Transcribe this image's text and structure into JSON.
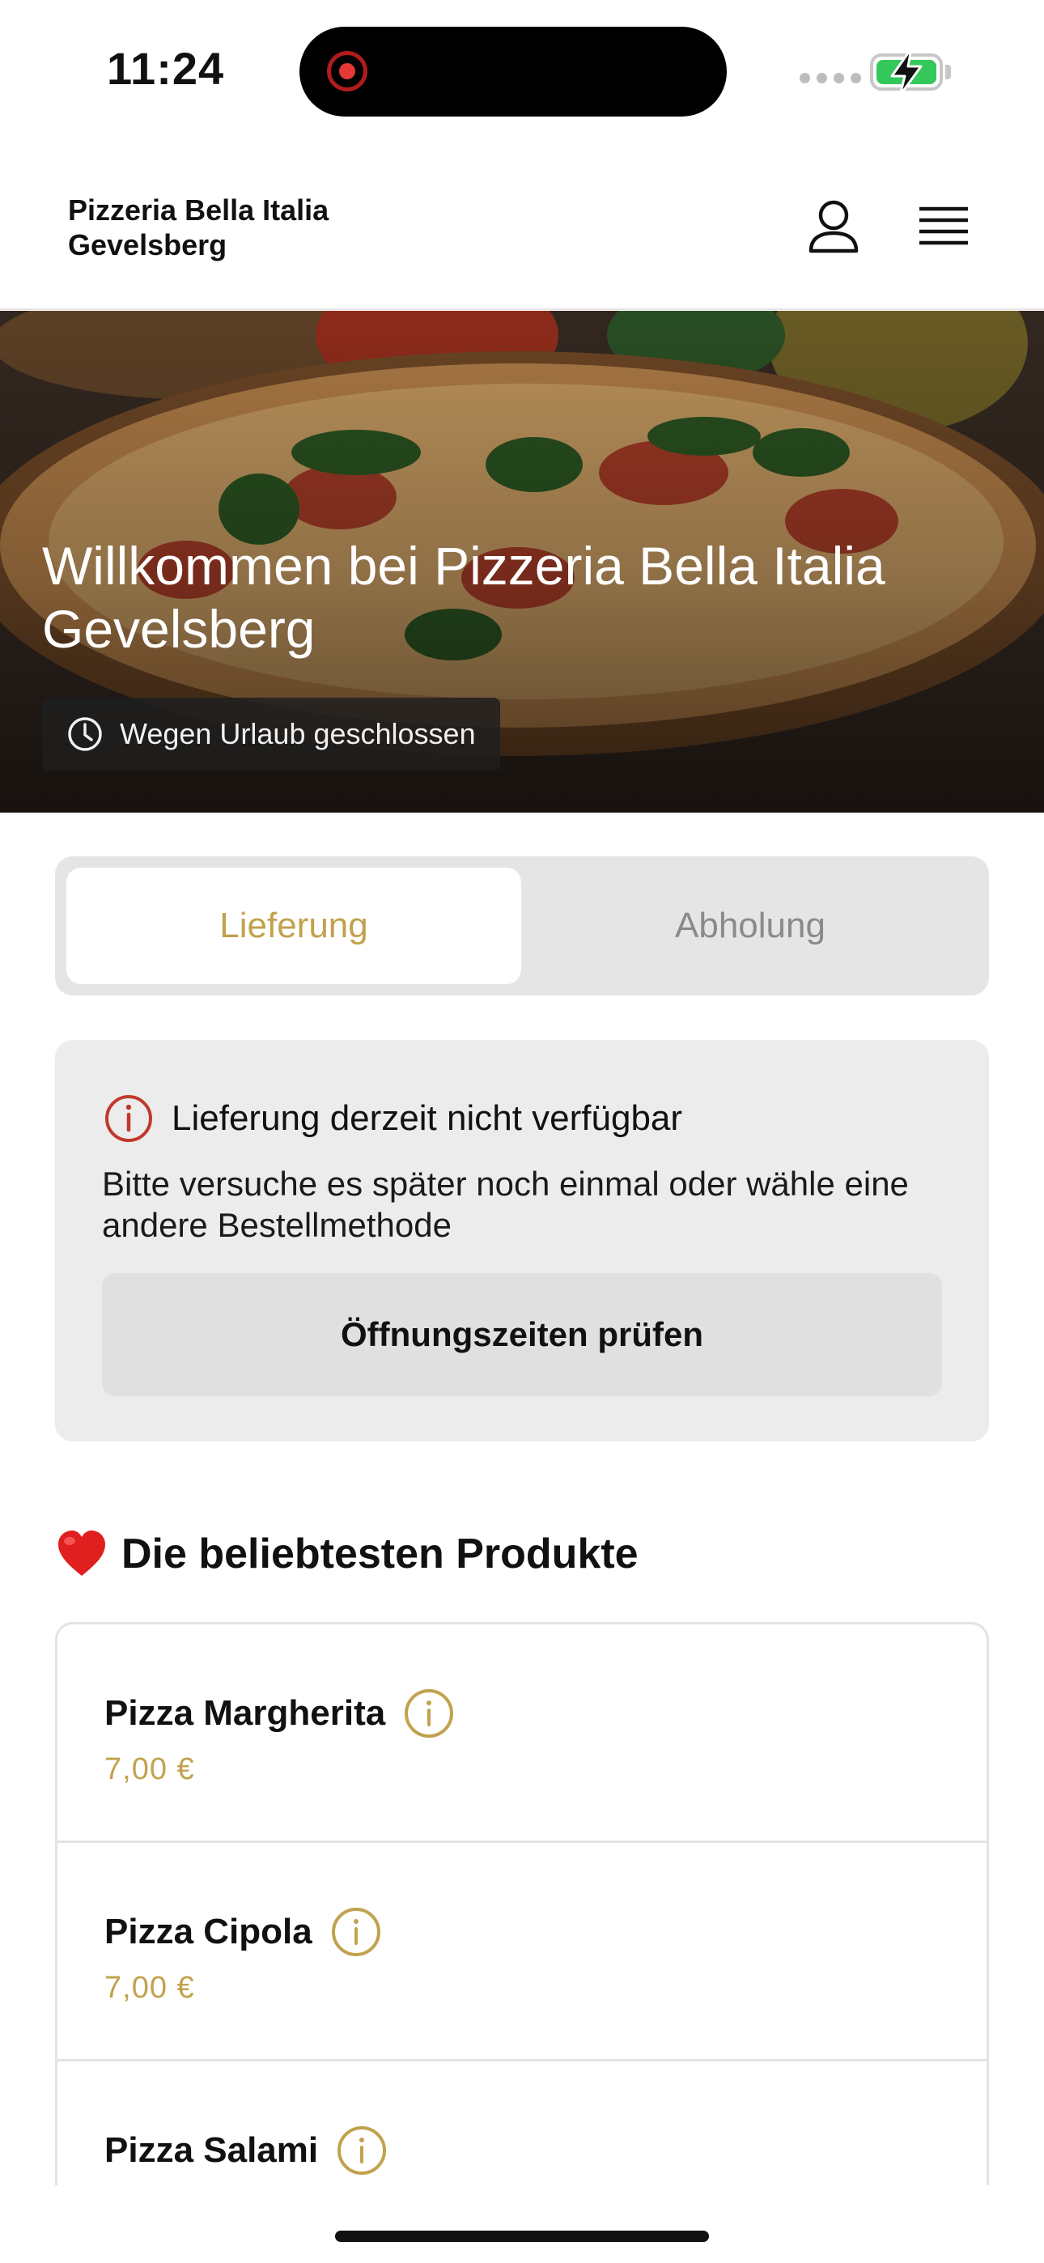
{
  "status_bar": {
    "time": "11:24"
  },
  "header": {
    "brand_line1": "Pizzeria Bella Italia",
    "brand_line2": "Gevelsberg"
  },
  "hero": {
    "title": "Willkommen bei Pizzeria Bella Italia Gevelsberg",
    "badge": "Wegen Urlaub geschlossen"
  },
  "order_mode": {
    "tabs": [
      "Lieferung",
      "Abholung"
    ],
    "selected": "Lieferung"
  },
  "notice": {
    "title": "Lieferung derzeit nicht verfügbar",
    "text": "Bitte versuche es später noch einmal oder wähle eine andere Bestellmethode",
    "button": "Öffnungszeiten prüfen"
  },
  "popular": {
    "heading": "Die beliebtesten Produkte",
    "items": [
      {
        "name": "Pizza Margherita",
        "price": "7,00 €"
      },
      {
        "name": "Pizza Cipola",
        "price": "7,00 €"
      },
      {
        "name": "Pizza Salami",
        "price": ""
      }
    ]
  },
  "colors": {
    "accent": "#c1a24d",
    "alert": "#c0392b",
    "battery": "#34c759"
  },
  "icons": [
    "record-icon",
    "battery-icon",
    "user-icon",
    "menu-icon",
    "clock-icon",
    "alert-info-icon",
    "heart-icon",
    "info-icon"
  ]
}
